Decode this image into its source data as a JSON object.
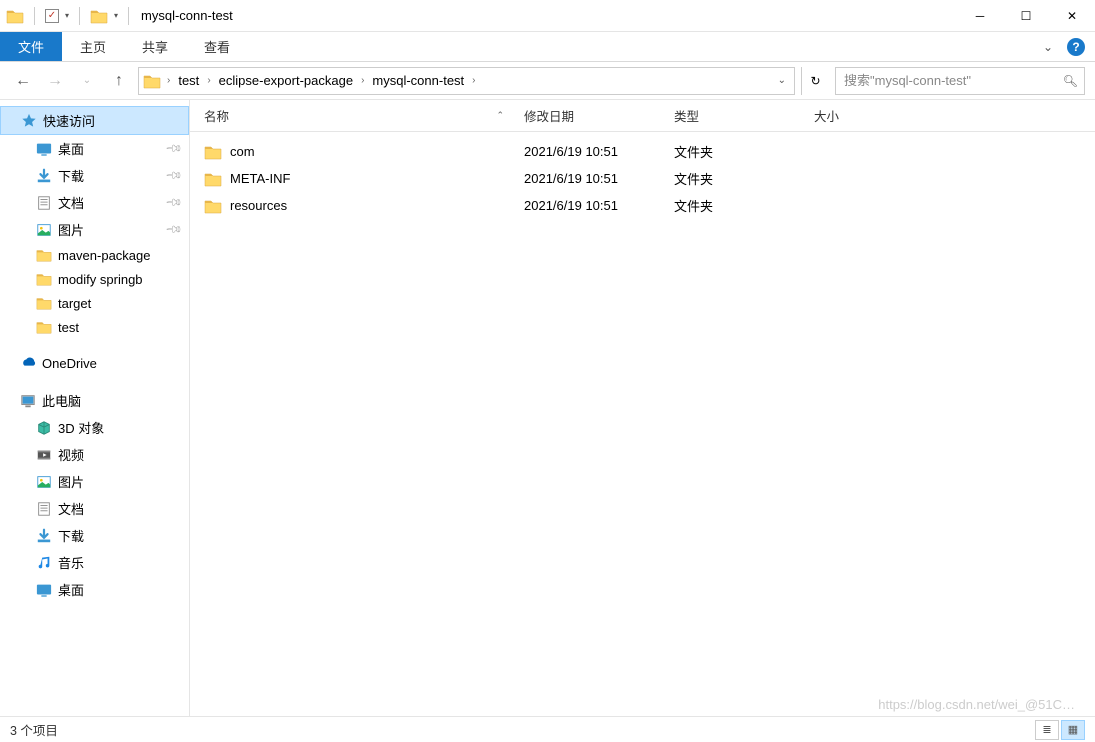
{
  "window": {
    "title": "mysql-conn-test"
  },
  "ribbon": {
    "file_tab": "文件",
    "tabs": [
      "主页",
      "共享",
      "查看"
    ]
  },
  "breadcrumbs": [
    "test",
    "eclipse-export-package",
    "mysql-conn-test"
  ],
  "search": {
    "placeholder": "搜索\"mysql-conn-test\""
  },
  "sidebar": {
    "quick_access": "快速访问",
    "quick_items": [
      {
        "label": "桌面",
        "icon": "desktop",
        "pinned": true
      },
      {
        "label": "下载",
        "icon": "download",
        "pinned": true
      },
      {
        "label": "文档",
        "icon": "document",
        "pinned": true
      },
      {
        "label": "图片",
        "icon": "picture",
        "pinned": true
      },
      {
        "label": "maven-package",
        "icon": "folder",
        "pinned": false
      },
      {
        "label": "modify springb",
        "icon": "folder",
        "pinned": false
      },
      {
        "label": "target",
        "icon": "folder",
        "pinned": false
      },
      {
        "label": "test",
        "icon": "folder",
        "pinned": false
      }
    ],
    "onedrive": "OneDrive",
    "this_pc": "此电脑",
    "pc_items": [
      {
        "label": "3D 对象",
        "icon": "3d"
      },
      {
        "label": "视频",
        "icon": "video"
      },
      {
        "label": "图片",
        "icon": "picture"
      },
      {
        "label": "文档",
        "icon": "document"
      },
      {
        "label": "下载",
        "icon": "download"
      },
      {
        "label": "音乐",
        "icon": "music"
      },
      {
        "label": "桌面",
        "icon": "desktop"
      }
    ]
  },
  "columns": {
    "name": "名称",
    "date": "修改日期",
    "type": "类型",
    "size": "大小"
  },
  "files": [
    {
      "name": "com",
      "date": "2021/6/19 10:51",
      "type": "文件夹"
    },
    {
      "name": "META-INF",
      "date": "2021/6/19 10:51",
      "type": "文件夹"
    },
    {
      "name": "resources",
      "date": "2021/6/19 10:51",
      "type": "文件夹"
    }
  ],
  "status": {
    "count_label": "3 个项目"
  },
  "watermark": "https://blog.csdn.net/wei_@51C…"
}
